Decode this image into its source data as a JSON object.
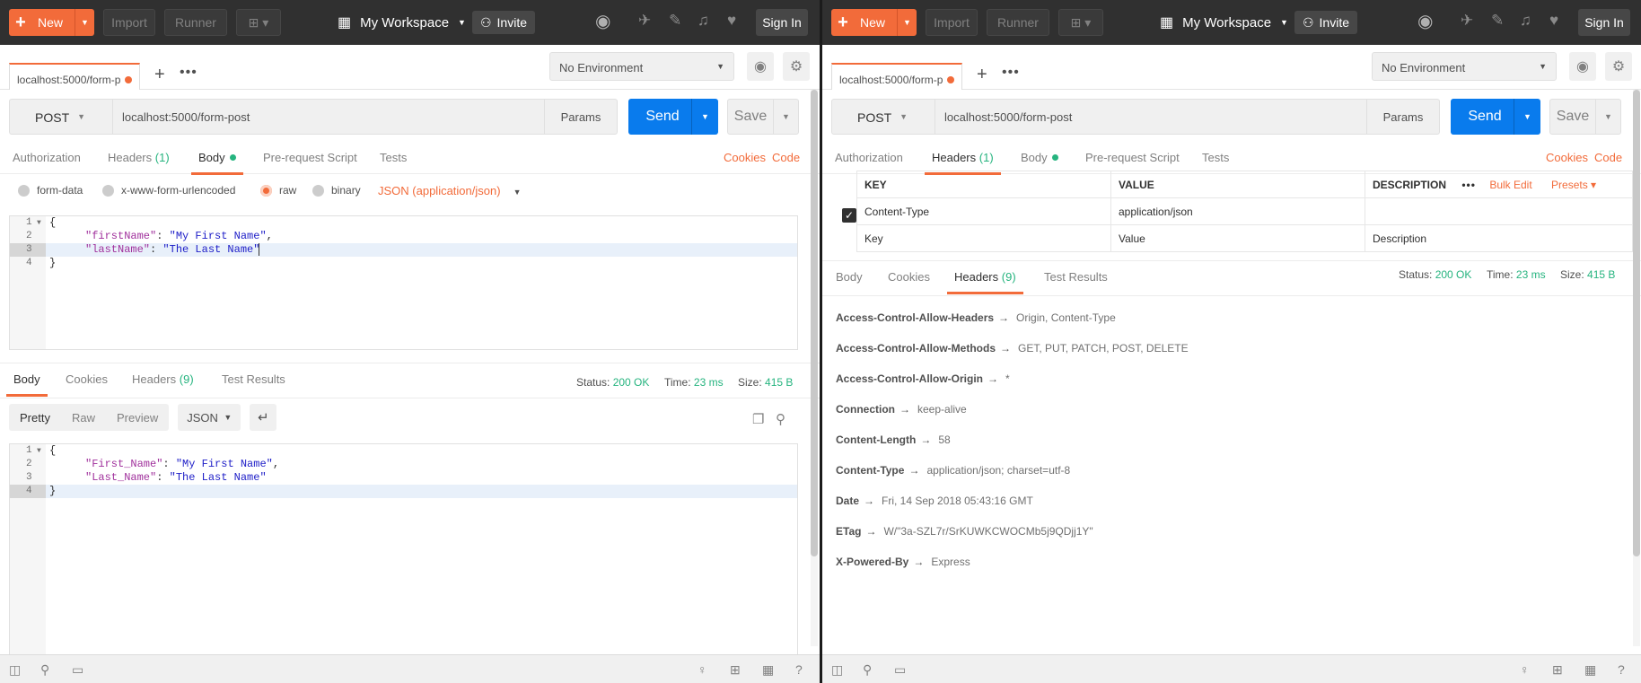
{
  "topbar": {
    "new_label": "New",
    "import_label": "Import",
    "runner_label": "Runner",
    "workspace": "My Workspace",
    "invite_label": "Invite",
    "signin_label": "Sign In",
    "accent": "#f26b3a"
  },
  "tab": {
    "title": "localhost:5000/form-p"
  },
  "environment": {
    "selected": "No Environment"
  },
  "request": {
    "method": "POST",
    "url": "localhost:5000/form-post",
    "params_label": "Params",
    "send_label": "Send",
    "save_label": "Save"
  },
  "request_tabs": {
    "authorization": "Authorization",
    "headers": "Headers",
    "headers_count": "(1)",
    "body": "Body",
    "prerequest": "Pre-request Script",
    "tests": "Tests",
    "cookies_link": "Cookies",
    "code_link": "Code"
  },
  "body_types": {
    "form_data": "form-data",
    "urlencoded": "x-www-form-urlencoded",
    "raw": "raw",
    "binary": "binary",
    "content_type": "JSON (application/json)"
  },
  "request_body": {
    "lines": [
      {
        "num": "1",
        "text": "{"
      },
      {
        "num": "2",
        "key": "\"firstName\"",
        "sep": ": ",
        "value": "\"My First Name\"",
        "tail": ","
      },
      {
        "num": "3",
        "key": "\"lastName\"",
        "sep": ": ",
        "value": "\"The Last Name\"",
        "tail": ""
      },
      {
        "num": "4",
        "text": "}"
      }
    ]
  },
  "response": {
    "tabs": {
      "body": "Body",
      "cookies": "Cookies",
      "headers": "Headers",
      "headers_count": "(9)",
      "test_results": "Test Results"
    },
    "status_label": "Status:",
    "status": "200 OK",
    "time_label": "Time:",
    "time": "23 ms",
    "size_label": "Size:",
    "size": "415 B",
    "format_tabs": {
      "pretty": "Pretty",
      "raw": "Raw",
      "preview": "Preview"
    },
    "format": "JSON",
    "body_lines": [
      {
        "num": "1",
        "text": "{"
      },
      {
        "num": "2",
        "key": "\"First_Name\"",
        "sep": ": ",
        "value": "\"My First Name\"",
        "tail": ","
      },
      {
        "num": "3",
        "key": "\"Last_Name\"",
        "sep": ": ",
        "value": "\"The Last Name\"",
        "tail": ""
      },
      {
        "num": "4",
        "text": "}"
      }
    ]
  },
  "header_table": {
    "col_key": "KEY",
    "col_value": "VALUE",
    "col_description": "DESCRIPTION",
    "bulk_edit": "Bulk Edit",
    "presets": "Presets",
    "rows": [
      {
        "key": "Content-Type",
        "value": "application/json",
        "description": ""
      }
    ],
    "placeholder_key": "Key",
    "placeholder_value": "Value",
    "placeholder_description": "Description"
  },
  "response_headers": [
    {
      "name": "Access-Control-Allow-Headers",
      "value": "Origin, Content-Type"
    },
    {
      "name": "Access-Control-Allow-Methods",
      "value": "GET, PUT, PATCH, POST, DELETE"
    },
    {
      "name": "Access-Control-Allow-Origin",
      "value": "*"
    },
    {
      "name": "Connection",
      "value": "keep-alive"
    },
    {
      "name": "Content-Length",
      "value": "58"
    },
    {
      "name": "Content-Type",
      "value": "application/json; charset=utf-8"
    },
    {
      "name": "Date",
      "value": "Fri, 14 Sep 2018 05:43:16 GMT"
    },
    {
      "name": "ETag",
      "value": "W/\"3a-SZL7r/SrKUWKCWOCMb5j9QDjj1Y\""
    },
    {
      "name": "X-Powered-By",
      "value": "Express"
    }
  ],
  "arrow": "→"
}
